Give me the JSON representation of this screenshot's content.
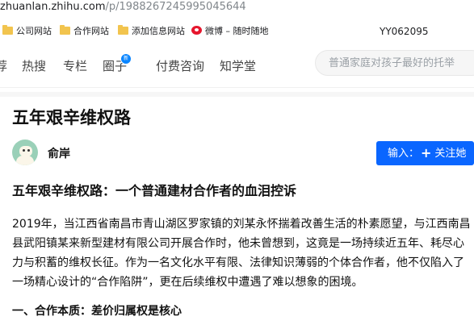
{
  "browser": {
    "url_host": "zhuanlan.zhihu.com",
    "url_path": "/p/1988267245995045644"
  },
  "bookmarks": {
    "items": [
      {
        "label": "公司网站",
        "icon": "folder-icon"
      },
      {
        "label": "合作网站",
        "icon": "folder-icon"
      },
      {
        "label": "添加信息网站",
        "icon": "folder-icon"
      },
      {
        "label": "微博 – 随时随地",
        "icon": "weibo-icon"
      }
    ],
    "code": "YY062095"
  },
  "nav": {
    "items": [
      "荐",
      "热搜",
      "专栏",
      "圈子",
      "付费咨询",
      "知学堂"
    ],
    "badge": "新",
    "search_placeholder": "普通家庭对孩子最好的托举"
  },
  "article": {
    "title": "五年艰辛维权路",
    "author": "俞岸",
    "follow_prefix": "输入：",
    "follow_label": "关注她",
    "heading": "五年艰辛维权路：一个普通建材合作者的血泪控诉",
    "paragraph_lines": [
      "2019年，当江西省南昌市青山湖区罗家镇的刘某永怀揣着改善生活的朴素愿望，与江西南昌",
      "县武阳镇某来新型建材有限公司开展合作时，他未曾想到，这竟是一场持续近五年、耗尽心",
      "力与积蓄的维权长征。作为一名文化水平有限、法律知识薄弱的个体合作者，他不仅陷入了",
      "一场精心设计的“合作陷阱”，更在后续维权中遭遇了难以想象的困境。"
    ],
    "section_heading": "一、合作本质：差价归属权是核心"
  },
  "colors": {
    "primary": "#0a66ff",
    "badge": "#0a85ff",
    "folder": "#f2c44e"
  }
}
